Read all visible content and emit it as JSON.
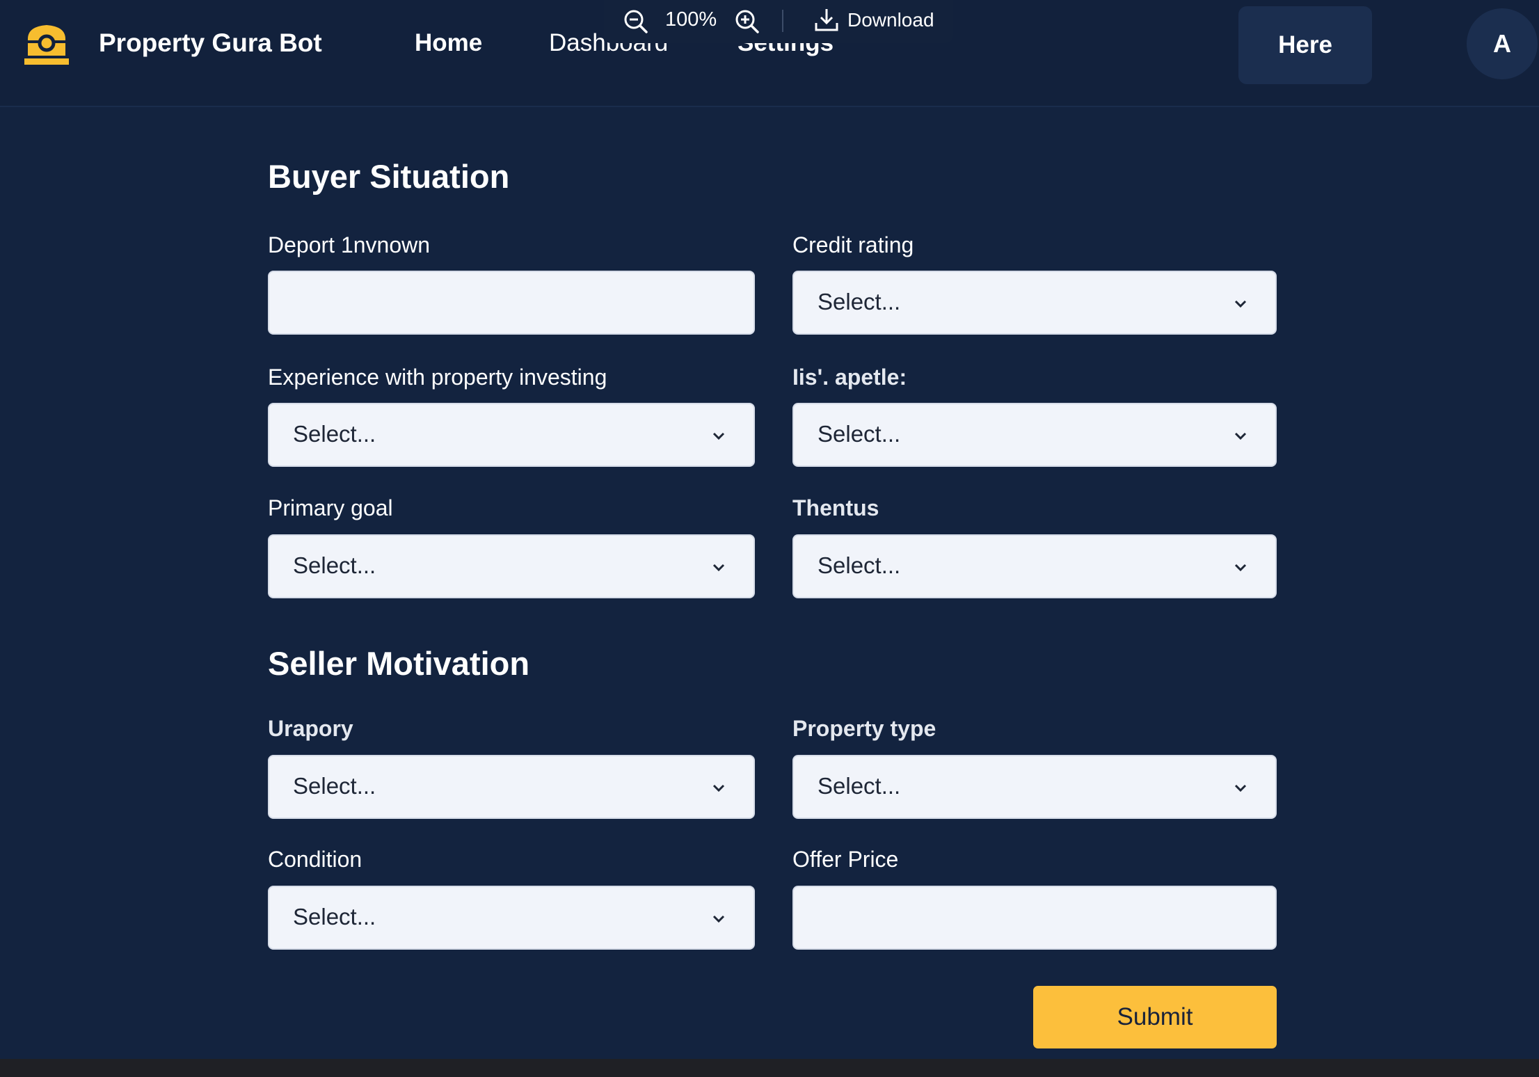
{
  "header": {
    "brand_name": "Property Gura Bot",
    "logo_icon": "house-logo-icon",
    "nav": [
      {
        "label": "Home"
      },
      {
        "label": "Dashboard"
      },
      {
        "label": "Settings"
      }
    ],
    "here_button": "Here",
    "avatar_initial": "A"
  },
  "zoombar": {
    "zoom_level": "100%",
    "download_label": "Download"
  },
  "buyer_section": {
    "title": "Buyer Situation",
    "fields": [
      {
        "label": "Deport 1nvnown",
        "type": "input",
        "value": ""
      },
      {
        "label": "Credit rating",
        "type": "select",
        "value": "Select..."
      },
      {
        "label": "Experience with property investing",
        "type": "select",
        "value": "Select..."
      },
      {
        "label": "Iis'. apetle:",
        "type": "select",
        "value": "Select..."
      },
      {
        "label": "Primary goal",
        "type": "select",
        "value": "Select..."
      },
      {
        "label": "Thentus",
        "type": "select",
        "value": "Select..."
      }
    ]
  },
  "seller_section": {
    "title": "Seller Motivation",
    "fields": [
      {
        "label": "Urapory",
        "type": "select",
        "value": "Select..."
      },
      {
        "label": "Property type",
        "type": "select",
        "value": "Select..."
      },
      {
        "label": "Condition",
        "type": "select",
        "value": "Select..."
      },
      {
        "label": "Offer Price",
        "type": "input",
        "value": ""
      }
    ]
  },
  "submit_label": "Submit",
  "colors": {
    "background": "#13233f",
    "accent": "#fcbf3c",
    "field_bg": "#f1f4fa"
  }
}
